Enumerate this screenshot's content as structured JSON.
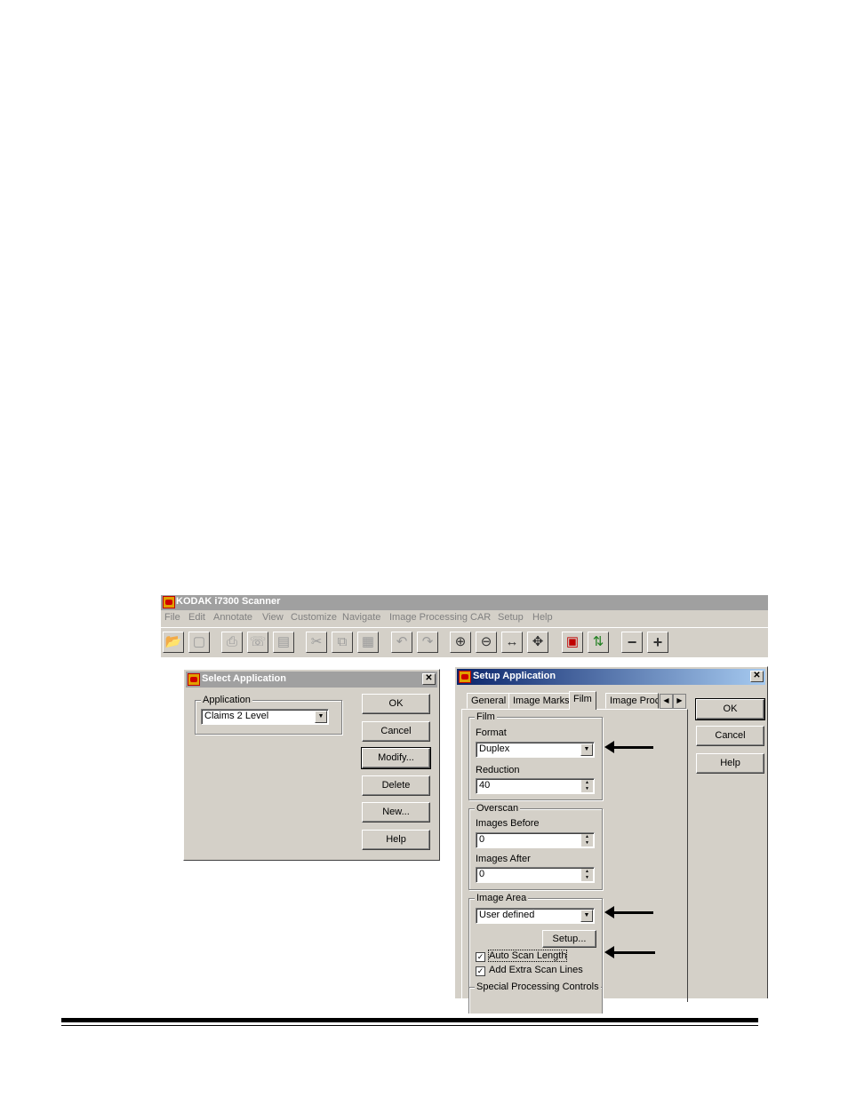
{
  "app": {
    "title": "KODAK i7300 Scanner",
    "menu": [
      "File",
      "Edit",
      "Annotate",
      "View",
      "Customize",
      "Navigate",
      "Image Processing",
      "CAR",
      "Setup",
      "Help"
    ]
  },
  "select_dialog": {
    "title": "Select Application",
    "group_label": "Application",
    "selected_value": "Claims 2 Level",
    "buttons": {
      "ok": "OK",
      "cancel": "Cancel",
      "modify": "Modify...",
      "delete": "Delete",
      "new": "New...",
      "help": "Help"
    }
  },
  "setup_dialog": {
    "title": "Setup Application",
    "tabs": [
      "General",
      "Image Marks",
      "Film",
      "Image Proce"
    ],
    "film": {
      "group_label": "Film",
      "format_label": "Format",
      "format_value": "Duplex",
      "reduction_label": "Reduction",
      "reduction_value": "40"
    },
    "overscan": {
      "group_label": "Overscan",
      "before_label": "Images Before",
      "before_value": "0",
      "after_label": "Images After",
      "after_value": "0"
    },
    "image_area": {
      "group_label": "Image Area",
      "value": "User defined",
      "setup_button": "Setup...",
      "auto_scan_label": "Auto Scan Length",
      "extra_lines_label": "Add Extra Scan Lines"
    },
    "special_label": "Special Processing Controls",
    "buttons": {
      "ok": "OK",
      "cancel": "Cancel",
      "help": "Help"
    }
  }
}
